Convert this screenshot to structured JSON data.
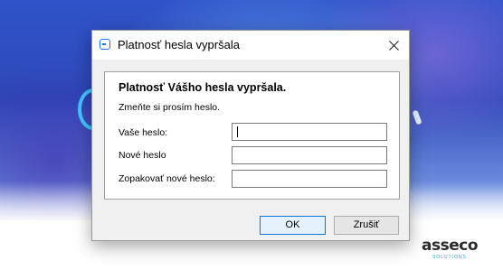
{
  "dialog": {
    "title": "Platnosť hesla vypršala",
    "heading": "Platnosť Vášho hesla vypršala.",
    "instruction": "Zmeňte si prosím heslo.",
    "fields": [
      {
        "label": "Vaše heslo:",
        "value": ""
      },
      {
        "label": "Nové heslo",
        "value": ""
      },
      {
        "label": "Zopakovať nové heslo:",
        "value": ""
      }
    ],
    "ok_label": "OK",
    "cancel_label": "Zrušiť"
  },
  "brand": {
    "name": "asseco",
    "subtitle": "SOLUTIONS"
  },
  "icons": {
    "app": "app-window-icon",
    "close": "close-icon"
  },
  "colors": {
    "accent": "#0078d7",
    "background_blue": "#2f53c9"
  }
}
